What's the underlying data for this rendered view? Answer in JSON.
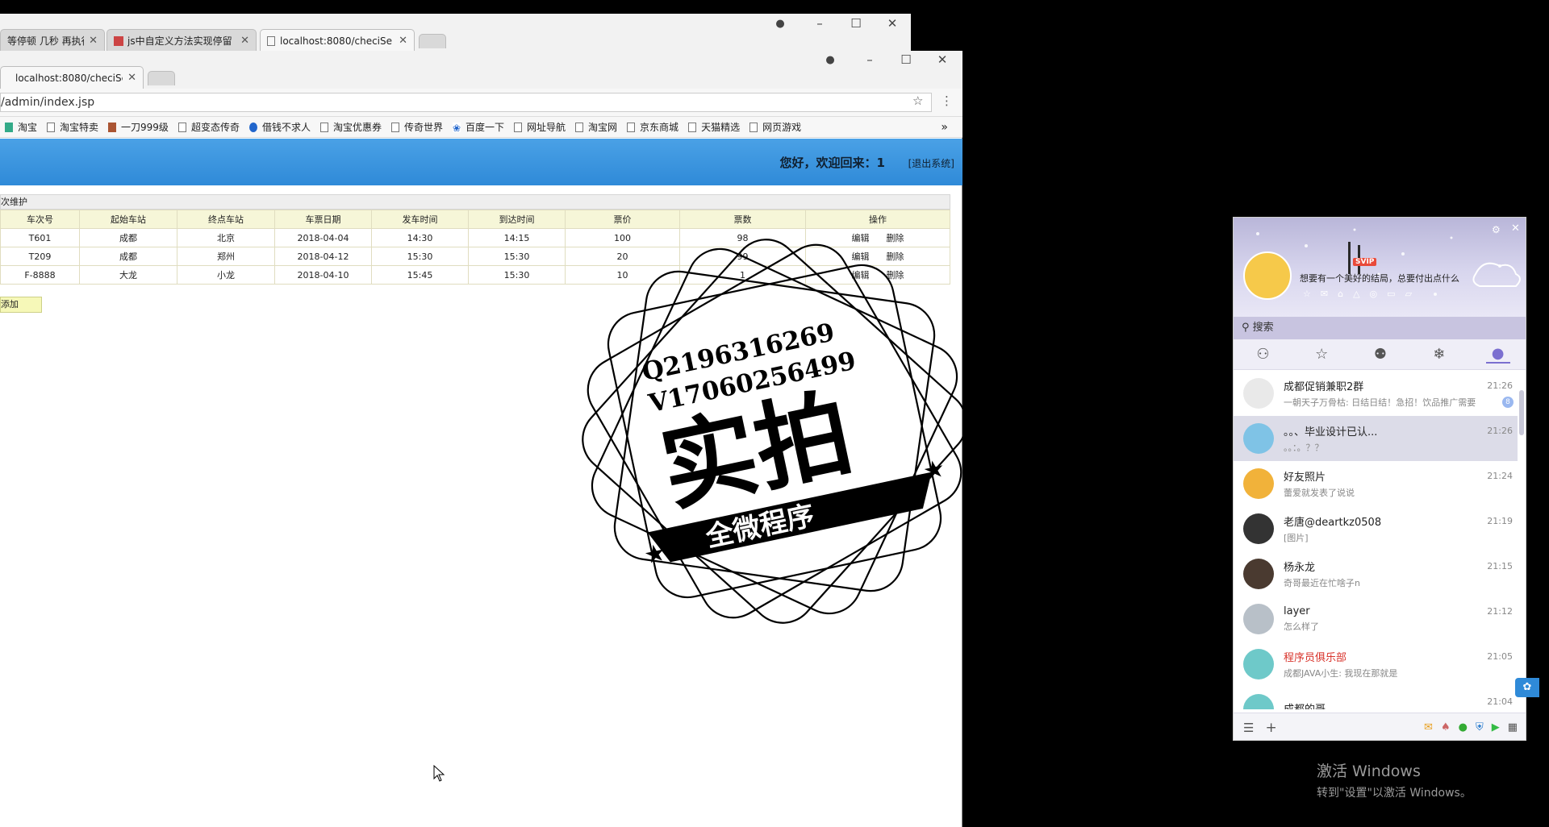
{
  "bg_browser": {
    "tabs": [
      "等停顿 几秒 再执行js",
      "js中自定义方法实现停留",
      "localhost:8080/checiSe"
    ]
  },
  "fg_browser": {
    "tab": "localhost:8080/checiSe",
    "url": "/admin/index.jsp",
    "bookmarks": [
      "淘宝",
      "淘宝特卖",
      "一刀999级",
      "超变态传奇",
      "借钱不求人",
      "淘宝优惠券",
      "传奇世界",
      "百度一下",
      "网址导航",
      "淘宝网",
      "京东商城",
      "天猫精选",
      "网页游戏"
    ],
    "more": "»"
  },
  "app": {
    "welcome": "您好，欢迎回来：1",
    "logout": "[退出系统]",
    "section_title": "次维护",
    "columns": [
      "车次号",
      "起始车站",
      "终点车站",
      "车票日期",
      "发车时间",
      "到达时间",
      "票价",
      "票数",
      "操作"
    ],
    "rows": [
      [
        "T601",
        "成都",
        "北京",
        "2018-04-04",
        "14:30",
        "14:15",
        "100",
        "98"
      ],
      [
        "T209",
        "成都",
        "郑州",
        "2018-04-12",
        "15:30",
        "15:30",
        "20",
        "99"
      ],
      [
        "F-8888",
        "大龙",
        "小龙",
        "2018-04-10",
        "15:45",
        "15:30",
        "10",
        "1"
      ]
    ],
    "edit_label": "编辑",
    "delete_label": "删除",
    "add_label": "添加"
  },
  "watermark": {
    "line1": "Q2196316269",
    "line2": "V17060256499",
    "main": "实拍",
    "ribbon": "全微程序"
  },
  "qq": {
    "signature": "想要有一个美好的结局，总要付出点什么",
    "vip": "SVIP",
    "search_placeholder": "搜索",
    "conversations": [
      {
        "name": "成都促销兼职2群",
        "msg": "一朝天子万骨枯: 日结日结！急招！饮品推广需要",
        "time": "21:26",
        "badge": "8",
        "color": "#e9e9e9"
      },
      {
        "name": "。。、毕业设计已认...",
        "msg": "。。：。？？",
        "time": "21:26",
        "color": "#7fc3e6"
      },
      {
        "name": "好友照片",
        "msg": "蕾爱就发表了说说",
        "time": "21:24",
        "color": "#f1b23a"
      },
      {
        "name": "老唐@deartkz0508",
        "msg": "[图片]",
        "time": "21:19",
        "color": "#333333"
      },
      {
        "name": "杨永龙",
        "msg": "奇哥最近在忙啥子n",
        "time": "21:15",
        "color": "#4a3a30"
      },
      {
        "name": "layer",
        "msg": "怎么样了",
        "time": "21:12",
        "color": "#b8c0c8"
      },
      {
        "name": "程序员俱乐部",
        "msg": "成都JAVA小生: 我现在那就是",
        "time": "21:05",
        "color": "#6ec9c9",
        "red": true
      },
      {
        "name": "成都的哥",
        "msg": "",
        "time": "21:04",
        "color": "#6ec9c9"
      }
    ]
  },
  "activation": {
    "title": "激活 Windows",
    "subtitle": "转到\"设置\"以激活 Windows。"
  }
}
